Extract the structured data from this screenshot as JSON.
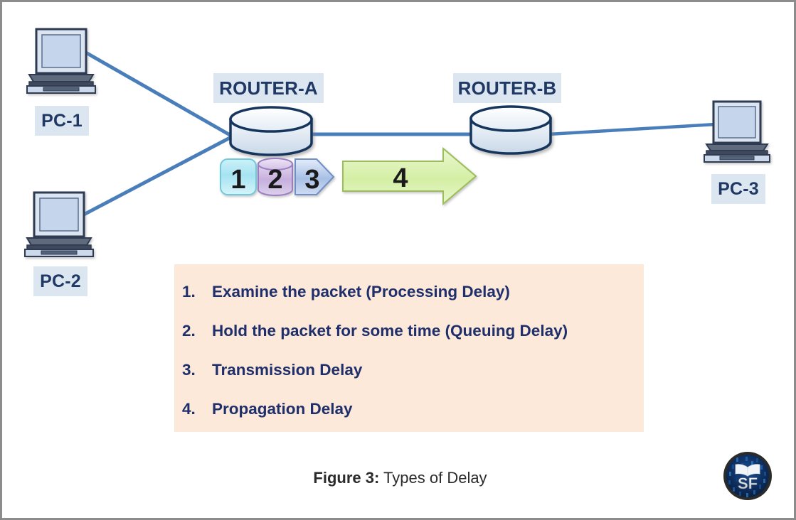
{
  "figure": {
    "caption_label": "Figure 3:",
    "caption_text": "Types of Delay"
  },
  "nodes": {
    "pc1": {
      "label": "PC-1",
      "icon": "laptop-icon"
    },
    "pc2": {
      "label": "PC-2",
      "icon": "laptop-icon"
    },
    "pc3": {
      "label": "PC-3",
      "icon": "laptop-icon"
    },
    "router_a": {
      "label": "ROUTER-A",
      "icon": "router-cylinder-icon"
    },
    "router_b": {
      "label": "ROUTER-B",
      "icon": "router-cylinder-icon"
    }
  },
  "packet_steps": [
    {
      "number": "1",
      "shape": "rounded-square",
      "color": "#a8e6f0"
    },
    {
      "number": "2",
      "shape": "cylinder",
      "color": "#c9b3dd"
    },
    {
      "number": "3",
      "shape": "pentagon-arrow",
      "color": "#9fb8e3"
    },
    {
      "number": "4",
      "shape": "right-arrow",
      "color": "#d7efa8"
    }
  ],
  "delay_list": [
    {
      "num": "1.",
      "text": "Examine the packet (Processing Delay)"
    },
    {
      "num": "2.",
      "text": "Hold the packet for some time (Queuing Delay)"
    },
    {
      "num": "3.",
      "text": "Transmission Delay"
    },
    {
      "num": "4.",
      "text": "Propagation Delay"
    }
  ],
  "logo": {
    "text": "SF",
    "icon": "open-book-icon"
  },
  "colors": {
    "label_bg": "#dce6f1",
    "label_text": "#1f3864",
    "list_bg": "#fce9d9",
    "list_text": "#1f2f6b",
    "link_line": "#4a7ebb",
    "router_outline": "#17365d",
    "border": "#8c8c8c"
  }
}
